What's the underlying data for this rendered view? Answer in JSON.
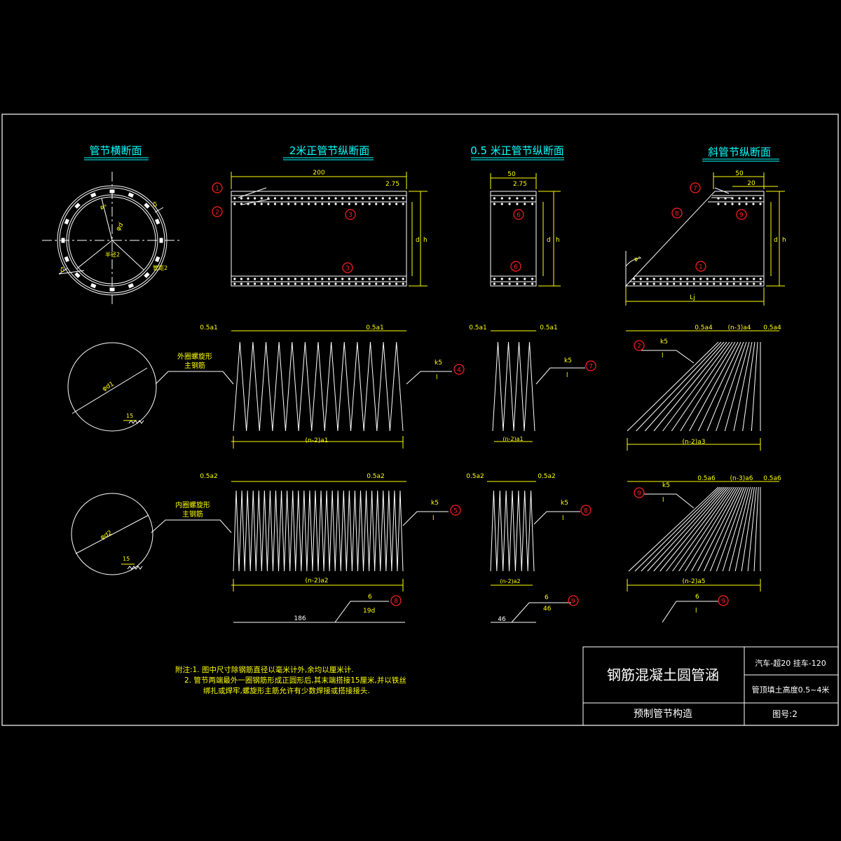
{
  "section_titles": {
    "cross_section": "管节横断面",
    "longitudinal_2m": "2米正管节纵断面",
    "longitudinal_05m": "0.5 米正管节纵断面",
    "skew": "斜管节纵断面"
  },
  "dimensions": {
    "len_200": "200",
    "len_50a": "50",
    "len_50b": "50",
    "d275a": "2.75",
    "d275b": "2.75",
    "d20": "20",
    "lj": "Lj",
    "half_a1_l": "0.5a1",
    "half_a1_r": "0.5a1",
    "half_a1_l2": "0.5a1",
    "half_a1_r2": "0.5a1",
    "half_a2_l": "0.5a2",
    "half_a2_r": "0.5a2",
    "half_a2_l2": "0.5a2",
    "half_a2_r2": "0.5a2",
    "half_a4_l": "0.5a4",
    "n3_a4": "(n-3)a4",
    "half_a4_r": "0.5a4",
    "half_a6_l": "0.5a6",
    "n3_a6": "(n-3)a6",
    "half_a6_r": "0.5a6",
    "n2_a1": "(n-2)a1",
    "n2_a1_short": "(n-2)a1",
    "n2_a3": "(n-2)a3",
    "n2_a2": "(n-2)a2",
    "n2_a2_short": "(n-2)a2",
    "n2_a5": "(n-2)a5",
    "v_d": "d",
    "v_h": "h",
    "phi_d1": "φd1",
    "phi_d2": "φd2",
    "phi_d": "φd",
    "len_15a": "15",
    "len_15b": "15",
    "delta_a": "δ",
    "delta_b": "δ",
    "bar_186": "186",
    "bar_46": "46",
    "ang_phi": "φ°"
  },
  "rebar_labels": {
    "outer_line1": "外圈螺旋形",
    "outer_line2": "主钢筋",
    "inner_line1": "内圈螺旋形",
    "inner_line2": "主钢筋",
    "rad_label": "半径2",
    "spacing_label": "管距2"
  },
  "callouts": [
    "1",
    "2",
    "3",
    "3",
    "6",
    "6",
    "7",
    "8",
    "9",
    "1",
    "4",
    "7",
    "2",
    "5",
    "8",
    "9",
    "8",
    "9"
  ],
  "bar_marks": {
    "k5_1": "k5",
    "k5_2": "k5",
    "k5_3": "k5",
    "k5_4": "k5",
    "k5_5": "k5",
    "k5_6": "k5",
    "six_1": "6",
    "six_2": "6",
    "six_3": "6",
    "b19d": "19d",
    "b46": "46",
    "one": "l"
  },
  "notes": {
    "line1": "附注:1. 图中尺寸除钢筋直径以毫米计外,余均以厘米计.",
    "line2": "2.   管节两端最外一圈钢筋形成正圆形后,其末端搭接15厘米,并以铁丝",
    "line3": "绑扎或焊牢,螺旋形主筋允许有少数焊接或搭接接头."
  },
  "title_block": {
    "main_title": "钢筋混凝土圆管涵",
    "load": "汽车-超20  挂车-120",
    "fill_height": "管顶填土高度0.5~4米",
    "subtitle": "预制管节构造",
    "drawing_no": "图号:2"
  },
  "colors": {
    "frame": "#ffffff",
    "dimension": "#ffff00",
    "callout": "#ff2020",
    "title": "#00ffff"
  }
}
